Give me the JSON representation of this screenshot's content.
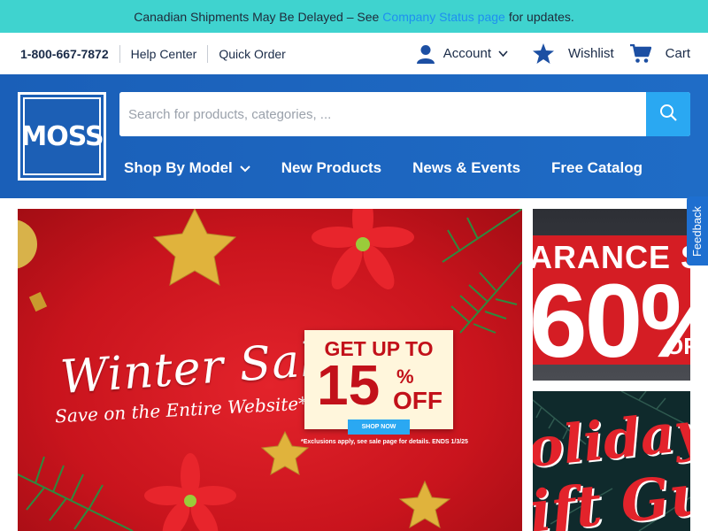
{
  "announcement": {
    "prefix": "Canadian Shipments May Be Delayed – See",
    "link": "Company Status page",
    "suffix": "for updates."
  },
  "utility": {
    "phone": "1-800-667-7872",
    "help": "Help Center",
    "quick_order": "Quick Order",
    "account": "Account",
    "wishlist": "Wishlist",
    "cart": "Cart"
  },
  "header": {
    "logo_text": "MOSS",
    "search_placeholder": "Search for products, categories, ...",
    "nav": [
      "Shop By Model",
      "New Products",
      "News & Events",
      "Free Catalog"
    ]
  },
  "hero": {
    "title": "Winter Sale",
    "subtitle": "Save on the Entire Website*",
    "offer_top": "GET UP TO",
    "offer_number": "15",
    "offer_percent": "%",
    "offer_off": "OFF",
    "shop_now": "SHOP NOW",
    "disclaimer": "*Exclusions apply, see sale page for details. ENDS 1/3/25"
  },
  "promos": {
    "clearance_band": "ARANCE S",
    "clearance_big": "60%",
    "clearance_tail": "OF",
    "holiday_line1": "oliday",
    "holiday_line2": "ift Gui"
  },
  "feedback_label": "Feedback",
  "colors": {
    "announcement_bg": "#3fd3cf",
    "header_blue": "#1a5fb8",
    "search_button": "#2aa8f2",
    "hero_red": "#c9141d"
  }
}
